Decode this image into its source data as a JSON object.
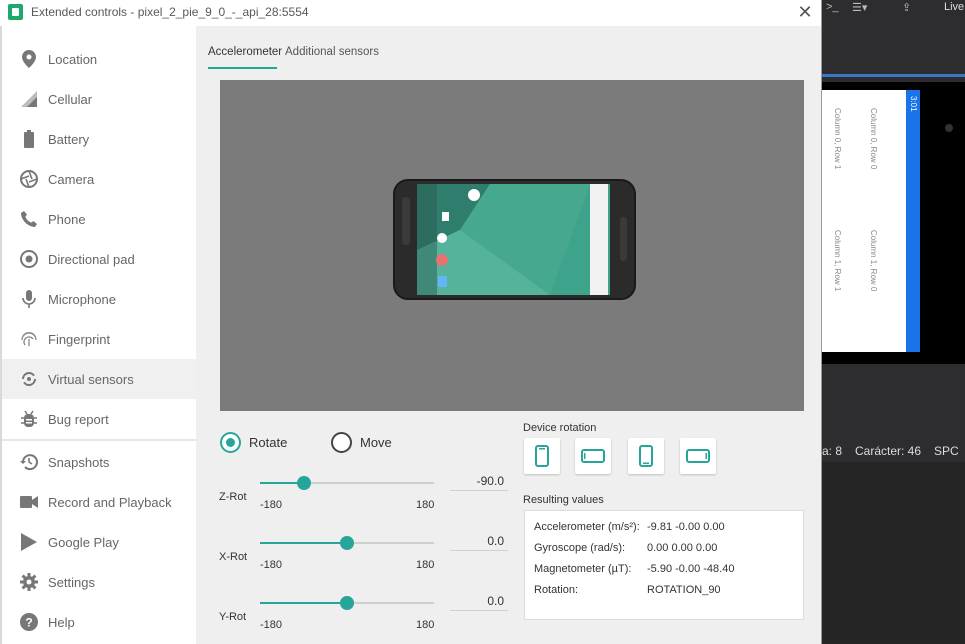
{
  "window": {
    "title": "Extended controls - pixel_2_pie_9_0_-_api_28:5554",
    "close_glyph": "✕"
  },
  "sidebar": {
    "items": [
      {
        "label": "Location",
        "icon": "location-pin-icon"
      },
      {
        "label": "Cellular",
        "icon": "signal-icon"
      },
      {
        "label": "Battery",
        "icon": "battery-icon"
      },
      {
        "label": "Camera",
        "icon": "camera-aperture-icon"
      },
      {
        "label": "Phone",
        "icon": "phone-icon"
      },
      {
        "label": "Directional pad",
        "icon": "dpad-icon"
      },
      {
        "label": "Microphone",
        "icon": "microphone-icon"
      },
      {
        "label": "Fingerprint",
        "icon": "fingerprint-icon"
      },
      {
        "label": "Virtual sensors",
        "icon": "rotation-icon",
        "active": true
      },
      {
        "label": "Bug report",
        "icon": "bug-icon"
      },
      {
        "label": "Snapshots",
        "icon": "history-icon"
      },
      {
        "label": "Record and Playback",
        "icon": "videocam-icon"
      },
      {
        "label": "Google Play",
        "icon": "play-store-icon"
      },
      {
        "label": "Settings",
        "icon": "gear-icon"
      },
      {
        "label": "Help",
        "icon": "help-icon"
      }
    ]
  },
  "tabs": [
    {
      "label": "Accelerometer",
      "active": true
    },
    {
      "label": "Additional sensors",
      "active": false
    }
  ],
  "mode": {
    "rotate_label": "Rotate",
    "move_label": "Move",
    "selected": "rotate"
  },
  "sliders": [
    {
      "name": "Z-Rot",
      "min_label": "-180",
      "max_label": "180",
      "value_text": "-90.0",
      "value": -90,
      "min": -180,
      "max": 180
    },
    {
      "name": "X-Rot",
      "min_label": "-180",
      "max_label": "180",
      "value_text": "0.0",
      "value": 0,
      "min": -180,
      "max": 180
    },
    {
      "name": "Y-Rot",
      "min_label": "-180",
      "max_label": "180",
      "value_text": "0.0",
      "value": 0,
      "min": -180,
      "max": 180
    }
  ],
  "device_rotation": {
    "label": "Device rotation",
    "buttons": [
      "portrait",
      "landscape",
      "reverse-portrait",
      "reverse-landscape"
    ]
  },
  "results": {
    "label": "Resulting values",
    "rows": [
      {
        "label": "Accelerometer (m/s²):",
        "value": "-9.81   -0.00   0.00"
      },
      {
        "label": "Gyroscope (rad/s):",
        "value": "0.00    0.00    0.00"
      },
      {
        "label": "Magnetometer (µT):",
        "value": "-5.90   -0.00   -48.40"
      },
      {
        "label": "Rotation:",
        "value": "ROTATION_90"
      }
    ]
  },
  "ide": {
    "toolbar_text": "Live",
    "status_line": "a: 8",
    "status_char": "Carácter: 46",
    "status_mode": "SPC",
    "emulator_app": {
      "time": "3:01",
      "cells": [
        "Column 0, Row 0",
        "Column 0, Row 1",
        "Column 1, Row 0",
        "Column 1, Row 1"
      ]
    }
  },
  "colors": {
    "accent": "#26a69a",
    "phone_wallpaper": "#3da38a"
  }
}
